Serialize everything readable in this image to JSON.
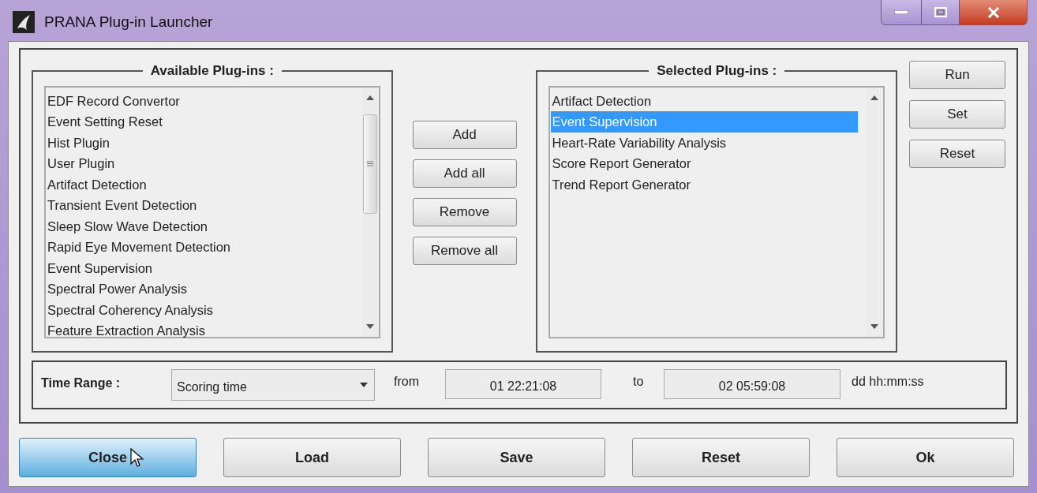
{
  "window": {
    "title": "PRANA Plug-in Launcher"
  },
  "available": {
    "title": "Available Plug-ins :",
    "items": [
      {
        "label": "EDF Record Convertor",
        "selected": false
      },
      {
        "label": "Event Setting Reset",
        "selected": false
      },
      {
        "label": "Hist Plugin",
        "selected": false
      },
      {
        "label": "User Plugin",
        "selected": false
      },
      {
        "label": "Artifact Detection",
        "selected": false
      },
      {
        "label": "Transient Event Detection",
        "selected": false
      },
      {
        "label": "Sleep Slow Wave Detection",
        "selected": false
      },
      {
        "label": "Rapid Eye Movement Detection",
        "selected": false
      },
      {
        "label": "Event Supervision",
        "selected": false
      },
      {
        "label": "Spectral Power Analysis",
        "selected": false
      },
      {
        "label": "Spectral Coherency Analysis",
        "selected": false
      },
      {
        "label": "Feature Extraction Analysis",
        "selected": false
      }
    ]
  },
  "transfer_buttons": [
    "Add",
    "Add all",
    "Remove",
    "Remove all"
  ],
  "selected_plugins": {
    "title": "Selected Plug-ins :",
    "items": [
      {
        "label": "Artifact Detection",
        "selected": false
      },
      {
        "label": "Event Supervision",
        "selected": true
      },
      {
        "label": "Heart-Rate Variability Analysis",
        "selected": false
      },
      {
        "label": "Score Report Generator",
        "selected": false
      },
      {
        "label": "Trend Report Generator",
        "selected": false
      }
    ]
  },
  "action_buttons": [
    "Run",
    "Set",
    "Reset"
  ],
  "time_range": {
    "label": "Time Range :",
    "mode": "Scoring time",
    "from_label": "from",
    "from": "01 22:21:08",
    "to_label": "to",
    "to": "02 05:59:08",
    "format": "dd hh:mm:ss"
  },
  "bottom_buttons": [
    {
      "label": "Close",
      "hovered": true
    },
    {
      "label": "Load",
      "hovered": false
    },
    {
      "label": "Save",
      "hovered": false
    },
    {
      "label": "Reset",
      "hovered": false
    },
    {
      "label": "Ok",
      "hovered": false
    }
  ]
}
